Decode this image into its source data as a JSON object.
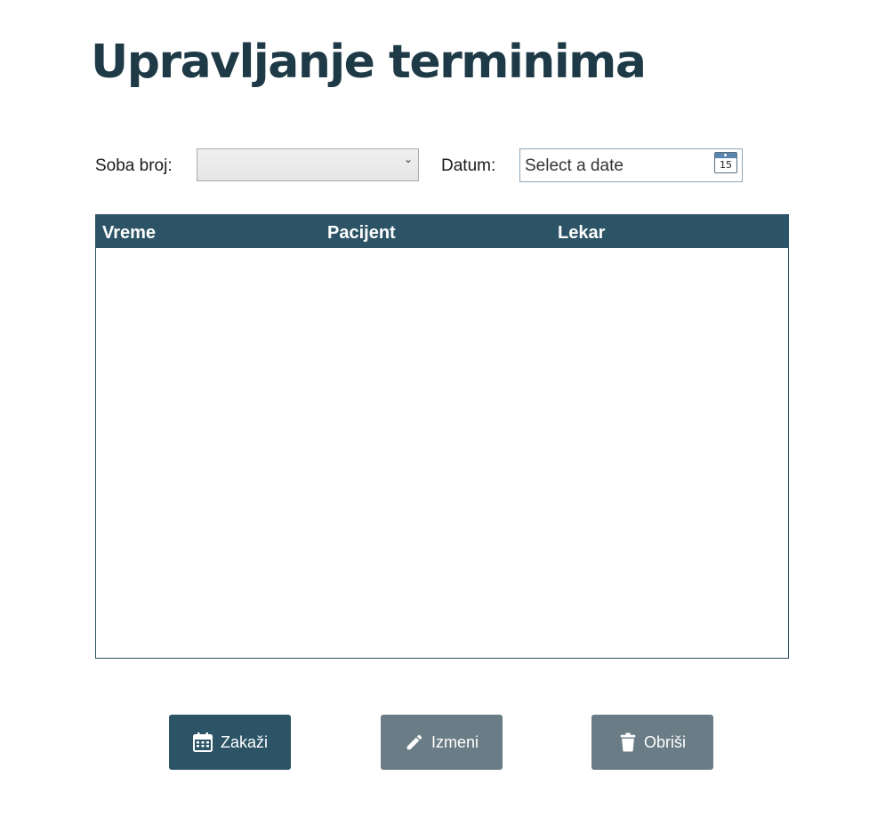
{
  "page": {
    "title": "Upravljanje terminima"
  },
  "filters": {
    "room_label": "Soba broj:",
    "room_value": "",
    "date_label": "Datum:",
    "date_placeholder": "Select a date",
    "calendar_icon_day": "15"
  },
  "table": {
    "columns": [
      "Vreme",
      "Pacijent",
      "Lekar"
    ],
    "rows": []
  },
  "actions": {
    "schedule_label": "Zakaži",
    "edit_label": "Izmeni",
    "delete_label": "Obriši"
  },
  "icons": {
    "room_dropdown": "chevron-down-icon",
    "date_picker": "calendar-icon",
    "schedule": "calendar-icon",
    "edit": "pencil-icon",
    "delete": "trash-icon"
  },
  "colors": {
    "title": "#1e3a47",
    "header": "#2c5466",
    "primary_button": "#2c5466",
    "secondary_button": "#6a7c85"
  }
}
